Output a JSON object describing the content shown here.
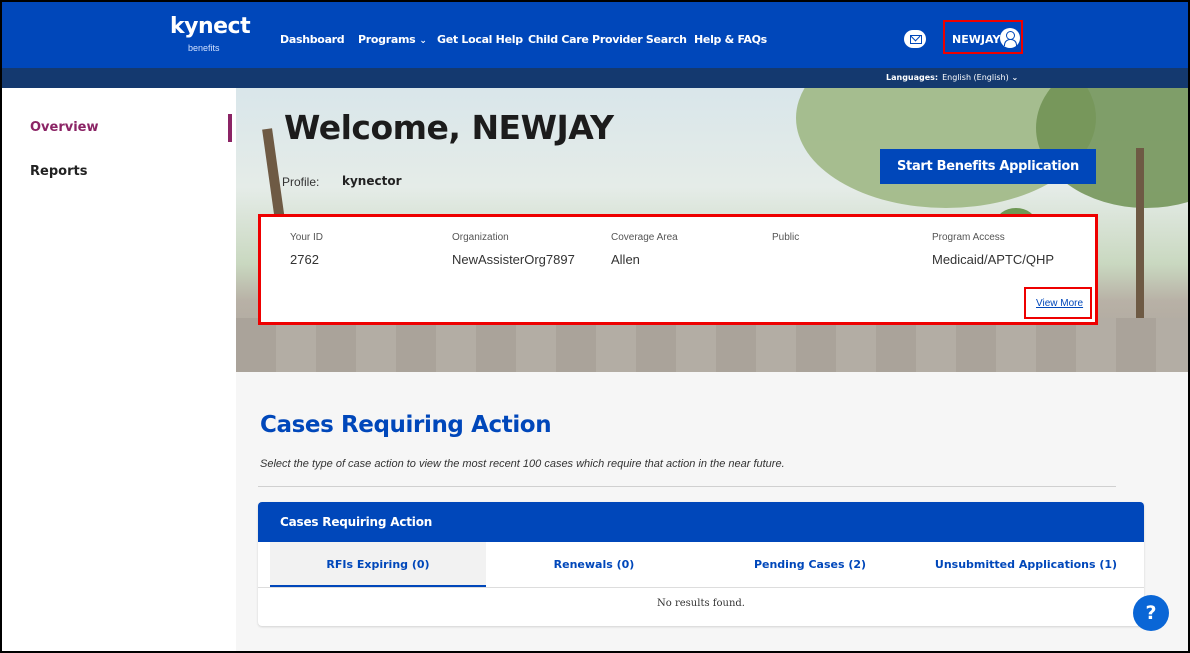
{
  "brand": {
    "logo": "kynect",
    "sub": "benefits"
  },
  "nav": {
    "links": [
      "Dashboard",
      "Programs",
      "Get Local Help",
      "Child Care Provider Search",
      "Help & FAQs"
    ],
    "chevron": "⌄",
    "user": "NEWJAY",
    "languages_label": "Languages:",
    "language_value": "English (English)",
    "language_chevron": "⌄"
  },
  "sidebar": {
    "items": [
      "Overview",
      "Reports"
    ]
  },
  "hero": {
    "welcome": "Welcome, NEWJAY",
    "profile_label": "Profile:",
    "profile_value": "kynector",
    "start_button": "Start Benefits Application"
  },
  "info": {
    "fields": [
      {
        "label": "Your ID",
        "value": "2762"
      },
      {
        "label": "Organization",
        "value": "NewAssisterOrg7897"
      },
      {
        "label": "Coverage Area",
        "value": "Allen"
      },
      {
        "label": "Public",
        "value": ""
      },
      {
        "label": "Program Access",
        "value": "Medicaid/APTC/QHP"
      }
    ],
    "view_more": "View More"
  },
  "cases": {
    "title": "Cases Requiring Action",
    "description": "Select the type of case action to view the most recent 100 cases which require that action in the near future.",
    "panel_title": "Cases Requiring Action",
    "tabs": [
      "RFIs Expiring (0)",
      "Renewals (0)",
      "Pending Cases (2)",
      "Unsubmitted Applications (1)"
    ],
    "empty": "No results found."
  },
  "help": {
    "label": "?"
  },
  "colors": {
    "primary": "#0047ba",
    "accent": "#8b2465",
    "highlight": "#ee0000"
  }
}
